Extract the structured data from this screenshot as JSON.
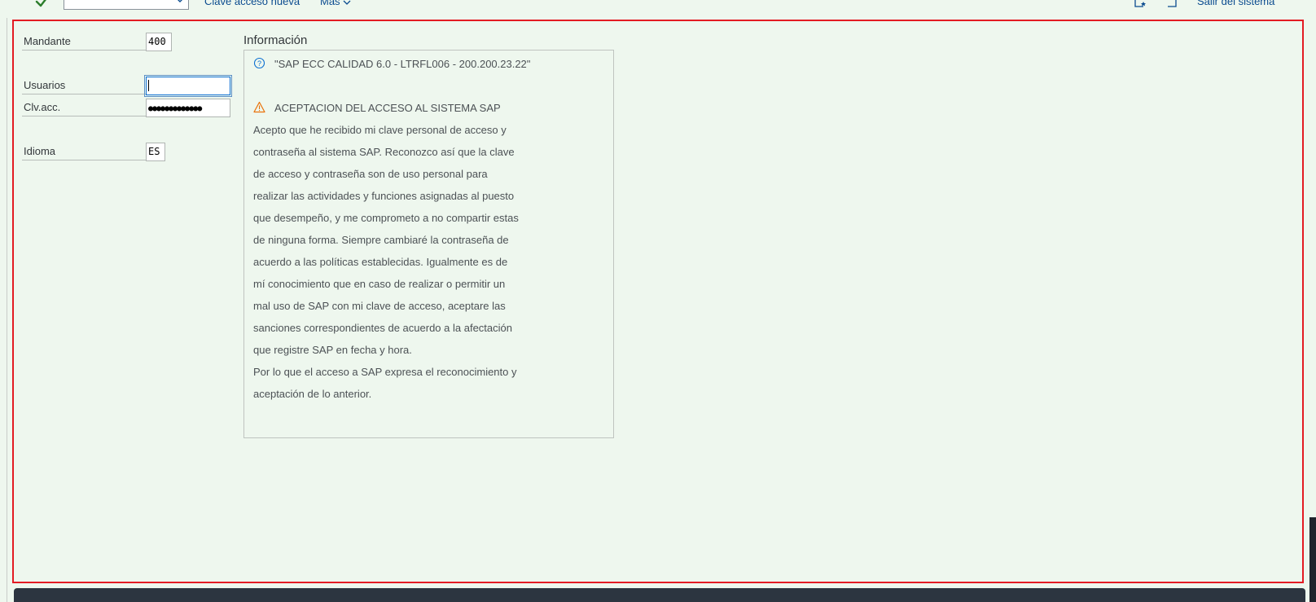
{
  "toolbar": {
    "command_field_value": "",
    "new_password_label": "Clave acceso nueva",
    "more_label": "Más",
    "logoff_label": "Salir del sistema"
  },
  "login": {
    "client_label": "Mandante",
    "client_value": "400",
    "user_label": "Usuarios",
    "user_value": "",
    "password_label": "Clv.acc.",
    "password_mask": "●●●●●●●●●●●●●",
    "language_label": "Idioma",
    "language_value": "ES"
  },
  "info": {
    "title": "Información",
    "system_line": "\"SAP ECC CALIDAD  6.0 - LTRFL006 - 200.200.23.22\"",
    "warning_heading": "ACEPTACION DEL ACCESO AL SISTEMA SAP",
    "body_lines": [
      "Acepto que he recibido mi clave personal de acceso y",
      "contraseña al sistema SAP. Reconozco así que la clave",
      "de acceso y contraseña son de uso personal para",
      "realizar las actividades y funciones asignadas al puesto",
      "que desempeño, y me comprometo a no compartir estas",
      "de ninguna forma. Siempre cambiaré la contraseña de",
      "acuerdo a las políticas establecidas. Igualmente es de",
      "mí conocimiento que en caso de realizar o permitir un",
      "mal uso de SAP con mi clave de acceso, aceptare las",
      "sanciones correspondientes de acuerdo a la afectación",
      "que registre SAP en fecha y hora.",
      "Por lo que el acceso a SAP expresa el reconocimiento y",
      "aceptación de lo anterior."
    ]
  },
  "colors": {
    "background": "#eef7ee",
    "highlight_border": "#e31b23",
    "link": "#0a4b8f",
    "check": "#2b7d2b",
    "warning": "#e9730c",
    "info_icon": "#0a6ed1",
    "statusbar": "#2c3540"
  },
  "icons": [
    "check-icon",
    "chevron-down-icon",
    "bookmark-star-icon",
    "refresh-window-icon",
    "question-circle-icon",
    "warning-triangle-icon"
  ]
}
